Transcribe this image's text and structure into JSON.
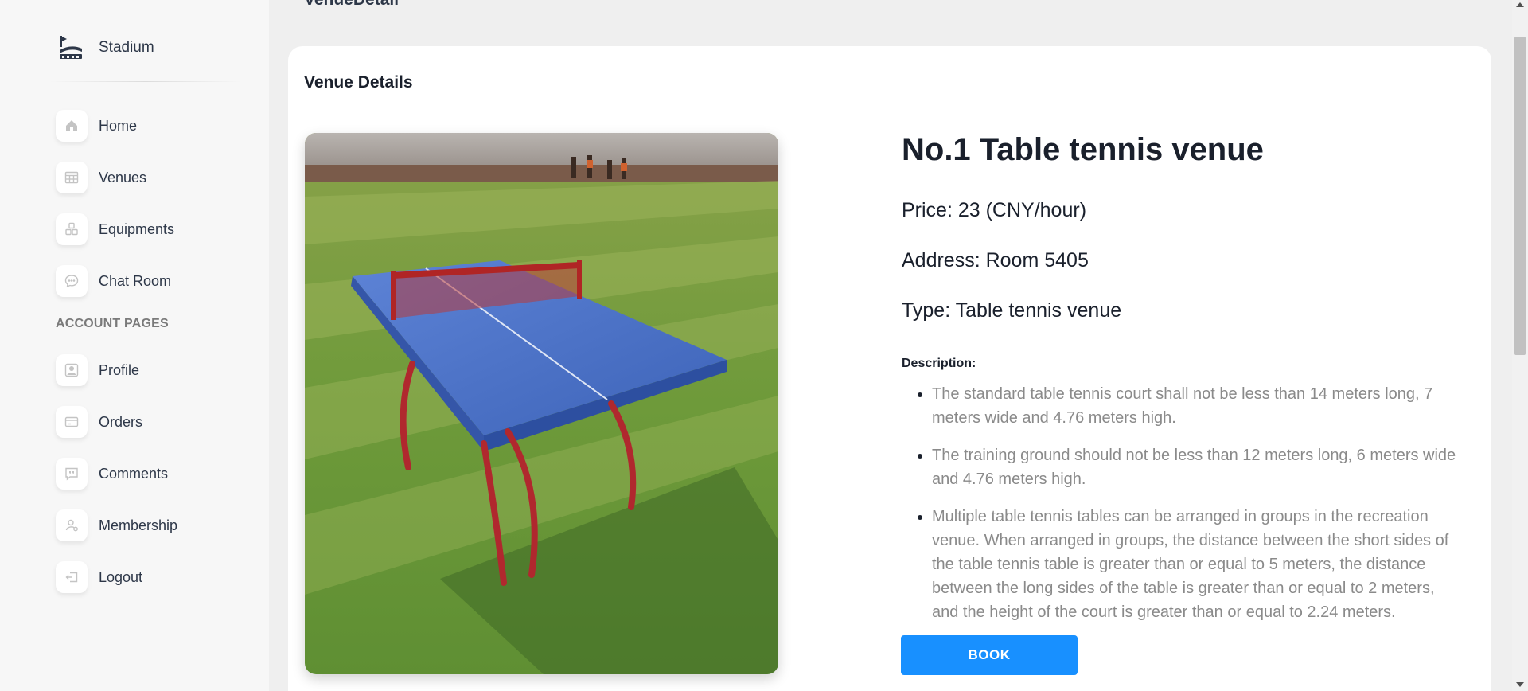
{
  "brand": {
    "name": "Stadium"
  },
  "page_title": "VenueDetail",
  "sidebar": {
    "items": [
      {
        "label": "Home",
        "icon": "home-icon"
      },
      {
        "label": "Venues",
        "icon": "table-grid-icon"
      },
      {
        "label": "Equipments",
        "icon": "equipment-icon"
      },
      {
        "label": "Chat Room",
        "icon": "chat-bubble-icon"
      }
    ],
    "section_title": "ACCOUNT PAGES",
    "account_items": [
      {
        "label": "Profile",
        "icon": "profile-icon"
      },
      {
        "label": "Orders",
        "icon": "credit-card-icon"
      },
      {
        "label": "Comments",
        "icon": "comment-quote-icon"
      },
      {
        "label": "Membership",
        "icon": "membership-icon"
      },
      {
        "label": "Logout",
        "icon": "logout-icon"
      }
    ]
  },
  "card": {
    "title": "Venue Details",
    "venue_name": "No.1 Table tennis venue",
    "price": "Price: 23 (CNY/hour)",
    "address": "Address: Room 5405",
    "type": "Type: Table tennis venue",
    "description_label": "Description:",
    "description": [
      "The standard table tennis court shall not be less than 14 meters long, 7 meters wide and 4.76 meters high.",
      "The training ground should not be less than 12 meters long, 6 meters wide and 4.76 meters high.",
      "Multiple table tennis tables can be arranged in groups in the recreation venue. When arranged in groups, the distance between the short sides of the table tennis table is greater than or equal to 5 meters, the distance between the long sides of the table is greater than or equal to 2 meters, and the height of the court is greater than or equal to 2.24 meters."
    ],
    "book_label": "BOOK"
  },
  "colors": {
    "accent": "#1890ff",
    "sidebar_bg": "#f7f7f7",
    "page_bg": "#efefef"
  }
}
